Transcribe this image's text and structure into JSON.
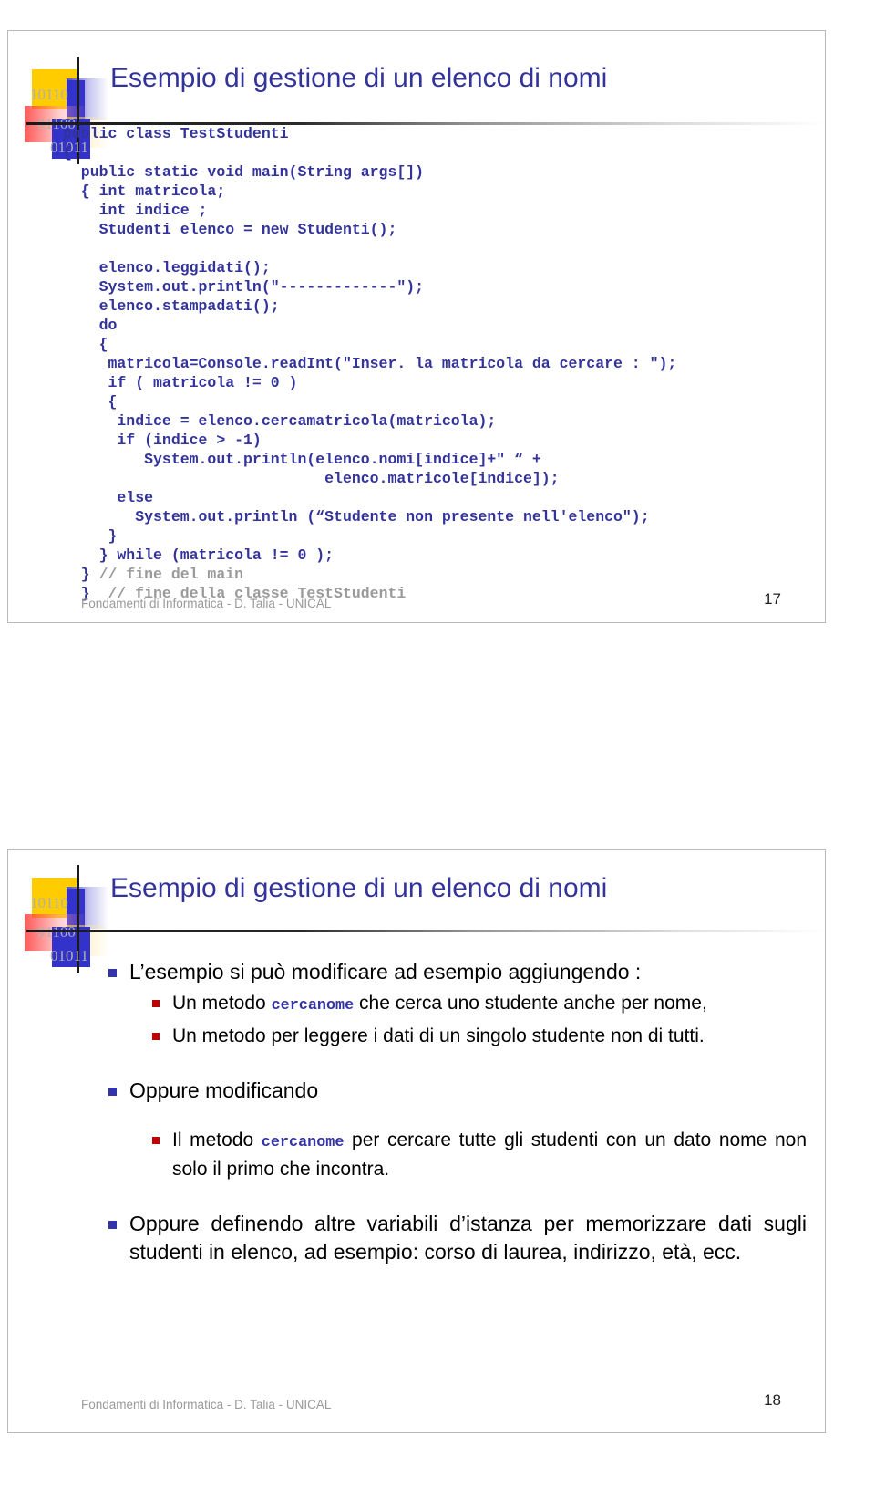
{
  "deck": {
    "title": "Esempio di gestione di un elenco di nomi",
    "accent_color": "#33339c",
    "bullet_lvl1_color": "#3333aa",
    "bullet_lvl2_color": "#c00000",
    "code_color": "#33339c",
    "comment_color": "#9a9a9a"
  },
  "logo": {
    "bits_top": "10110",
    "bits_mid": "01100",
    "bits_bottom": "01011"
  },
  "slide1": {
    "title": "Esempio di gestione di un elenco di nomi",
    "code_lines": [
      "public class TestStudenti",
      "{",
      "  public static void main(String args[])",
      "  { int matricola;",
      "    int indice ;",
      "    Studenti elenco = new Studenti();",
      "",
      "    elenco.leggidati();",
      "    System.out.println(\"-------------\");",
      "    elenco.stampadati();",
      "    do",
      "    {",
      "     matricola=Console.readInt(\"Inser. la matricola da cercare : \");",
      "     if ( matricola != 0 )",
      "     {",
      "      indice = elenco.cercamatricola(matricola);",
      "      if (indice > -1)",
      "         System.out.println(elenco.nomi[indice]+\" “ +",
      "                             elenco.matricole[indice]);",
      "      else",
      "        System.out.println (“Studente non presente nell'elenco\");",
      "     }",
      "    } while (matricola != 0 );"
    ],
    "code_comment_lines": [
      {
        "code": "  } ",
        "comment": "// fine del main"
      },
      {
        "code": "  }  ",
        "comment": "// fine della classe TestStudenti"
      }
    ],
    "footer": "Fondamenti di Informatica - D. Talia - UNICAL",
    "page_number": "17"
  },
  "slide2": {
    "title": "Esempio di gestione di un elenco di nomi",
    "bullets": [
      {
        "level": 1,
        "parts": [
          {
            "type": "text",
            "value": "L’esempio si può modificare ad esempio aggiungendo :"
          }
        ]
      },
      {
        "level": 2,
        "parts": [
          {
            "type": "text",
            "value": "Un metodo "
          },
          {
            "type": "code",
            "value": "cercanome"
          },
          {
            "type": "text",
            "value": " che cerca uno studente anche per nome,"
          }
        ]
      },
      {
        "level": 2,
        "parts": [
          {
            "type": "text",
            "value": "Un metodo per leggere i dati di un singolo studente non di tutti."
          }
        ]
      },
      {
        "level": 1,
        "spacer_before": "large",
        "parts": [
          {
            "type": "text",
            "value": "Oppure modificando"
          }
        ]
      },
      {
        "level": 2,
        "justify": true,
        "spacer_before": "medium",
        "parts": [
          {
            "type": "text",
            "value": "Il metodo "
          },
          {
            "type": "code",
            "value": "cercanome"
          },
          {
            "type": "text",
            "value": " per cercare tutte gli studenti con un dato nome non solo il primo che incontra."
          }
        ]
      },
      {
        "level": 1,
        "justify": true,
        "spacer_before": "large",
        "parts": [
          {
            "type": "text",
            "value": "Oppure definendo altre variabili d’istanza per memorizzare dati sugli studenti in elenco, ad esempio: corso di laurea, indirizzo, età, ecc."
          }
        ]
      }
    ],
    "footer": "Fondamenti di Informatica - D. Talia - UNICAL",
    "page_number": "18"
  }
}
